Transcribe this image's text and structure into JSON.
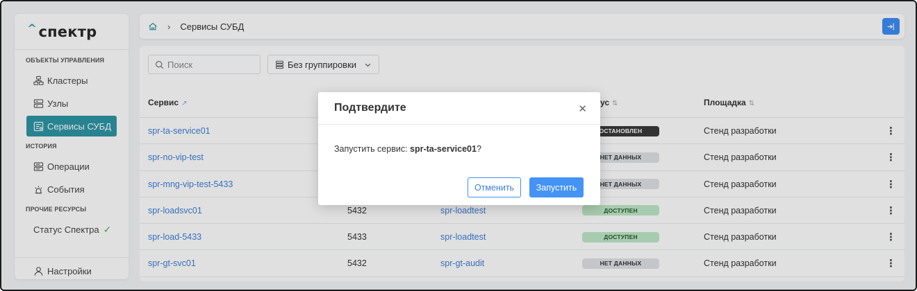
{
  "sidebar": {
    "logo": "спектр",
    "sections": {
      "objects": "Объекты управления",
      "history": "История",
      "other": "Прочие ресурсы"
    },
    "items": {
      "clusters": "Кластеры",
      "nodes": "Узлы",
      "services": "Сервисы СУБД",
      "operations": "Операции",
      "events": "События",
      "status": "Статус Спектра",
      "settings": "Настройки"
    }
  },
  "header": {
    "breadcrumb": "Сервисы СУБД"
  },
  "toolbar": {
    "search_placeholder": "Поиск",
    "grouping": "Без группировки"
  },
  "table": {
    "columns": {
      "service": "Сервис",
      "status": "ус",
      "site": "Площадка"
    },
    "rows": [
      {
        "service": "spr-ta-service01",
        "port": "",
        "cluster": "",
        "status": "ОСТАНОВЛЕН",
        "status_type": "stopped",
        "site": "Стенд разработки"
      },
      {
        "service": "spr-no-vip-test",
        "port": "",
        "cluster": "",
        "status": "НЕТ ДАННЫХ",
        "status_type": "nodata",
        "site": "Стенд разработки"
      },
      {
        "service": "spr-mng-vip-test-5433",
        "port": "",
        "cluster": "",
        "status": "НЕТ ДАННЫХ",
        "status_type": "nodata",
        "site": "Стенд разработки"
      },
      {
        "service": "spr-loadsvc01",
        "port": "5432",
        "cluster": "spr-loadtest",
        "status": "ДОСТУПЕН",
        "status_type": "avail",
        "site": "Стенд разработки"
      },
      {
        "service": "spr-load-5433",
        "port": "5433",
        "cluster": "spr-loadtest",
        "status": "ДОСТУПЕН",
        "status_type": "avail",
        "site": "Стенд разработки"
      },
      {
        "service": "spr-gt-svc01",
        "port": "5432",
        "cluster": "spr-gt-audit",
        "status": "НЕТ ДАННЫХ",
        "status_type": "nodata",
        "site": "Стенд разработки"
      }
    ]
  },
  "modal": {
    "title": "Подтвердите",
    "message_prefix": "Запустить сервис: ",
    "service_name": "spr-ta-service01",
    "message_suffix": "?",
    "cancel_label": "Отменить",
    "confirm_label": "Запустить"
  },
  "colors": {
    "accent": "#2e96a5",
    "primary_button": "#4493f5",
    "link": "#3d7fd9"
  }
}
